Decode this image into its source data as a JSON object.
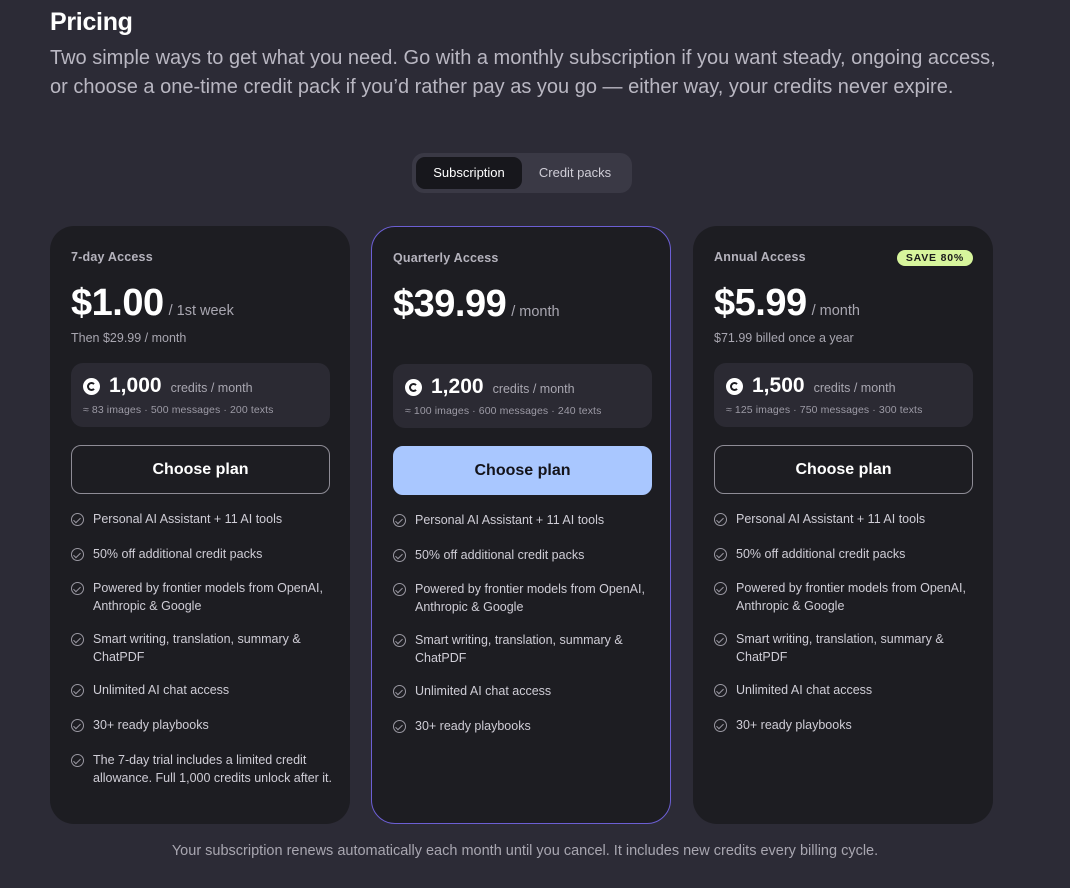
{
  "header": {
    "title": "Pricing",
    "intro": "Two simple ways to get what you need. Go with a monthly subscription if you want steady, ongoing access, or choose a one-time credit pack if you’d rather pay as you go — either way, your credits never expire."
  },
  "toggle": {
    "options": [
      {
        "label": "Subscription",
        "active": true
      },
      {
        "label": "Credit packs",
        "active": false
      }
    ]
  },
  "plans": [
    {
      "name": "7-day Access",
      "badge": "",
      "price": "$1.00",
      "period": "/ 1st week",
      "billing": "Then $29.99 / month",
      "credits_amount": "1,000",
      "credits_unit": "credits / month",
      "credits_breakdown": "≈ 83 images · 500 messages · 200 texts",
      "cta": "Choose plan",
      "features": [
        "Personal AI Assistant + 11 AI tools",
        "50% off additional credit packs",
        "Powered by frontier models from OpenAI, Anthropic & Google",
        "Smart writing, translation, summary & ChatPDF",
        "Unlimited AI chat access",
        "30+ ready playbooks",
        "The 7-day trial includes a limited credit allowance. Full 1,000 credits unlock after it."
      ]
    },
    {
      "name": "Quarterly Access",
      "badge": "",
      "price": "$39.99",
      "period": "/ month",
      "billing": "",
      "credits_amount": "1,200",
      "credits_unit": "credits / month",
      "credits_breakdown": "≈ 100 images · 600 messages · 240 texts",
      "cta": "Choose plan",
      "features": [
        "Personal AI Assistant + 11 AI tools",
        "50% off additional credit packs",
        "Powered by frontier models from OpenAI, Anthropic & Google",
        "Smart writing, translation, summary & ChatPDF",
        "Unlimited AI chat access",
        "30+ ready playbooks"
      ]
    },
    {
      "name": "Annual Access",
      "badge": "SAVE 80%",
      "price": "$5.99",
      "period": "/ month",
      "billing": "$71.99 billed once a year",
      "credits_amount": "1,500",
      "credits_unit": "credits / month",
      "credits_breakdown": "≈ 125 images · 750 messages · 300 texts",
      "cta": "Choose plan",
      "features": [
        "Personal AI Assistant + 11 AI tools",
        "50% off additional credit packs",
        "Powered by frontier models from OpenAI, Anthropic & Google",
        "Smart writing, translation, summary & ChatPDF",
        "Unlimited AI chat access",
        "30+ ready playbooks"
      ]
    }
  ],
  "footer": {
    "note": "Your subscription renews automatically each month until you cancel. It includes new credits every billing cycle."
  },
  "colors": {
    "page_bg": "#2c2b36",
    "card_bg": "#1d1d22",
    "featured_border": "#6c5fd4",
    "primary_button": "#a9c7ff",
    "badge_bg": "#d7f59c"
  },
  "icons": {
    "credit": "credit-coin-icon",
    "feature": "check-circle-icon"
  }
}
